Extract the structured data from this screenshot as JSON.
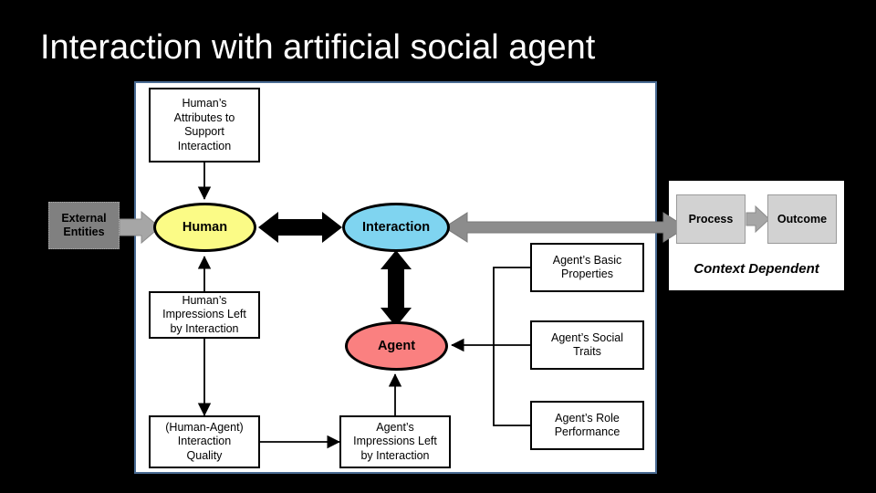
{
  "slide": {
    "title": "Interaction with artificial social agent",
    "background_color": "#000000",
    "title_color": "#ffffff"
  },
  "colors": {
    "human_fill": "#fbfb86",
    "interaction_fill": "#7fd4f0",
    "agent_fill": "#fa8080",
    "external_fill": "#808080",
    "process_fill": "#d2d2d2",
    "panel_border": "#4a6b93",
    "arrow_gray": "#8c8c8c",
    "arrow_black": "#000000"
  },
  "diagram": {
    "nodes": {
      "external_entities": "External\nEntities",
      "human": "Human",
      "interaction": "Interaction",
      "agent": "Agent",
      "human_attributes": "Human’s\nAttributes to\nSupport\nInteraction",
      "human_impressions": "Human’s\nImpressions Left\nby Interaction",
      "interaction_quality": "(Human-Agent)\nInteraction\nQuality",
      "agent_impressions": "Agent’s\nImpressions Left\nby Interaction",
      "agent_basic": "Agent’s Basic\nProperties",
      "agent_social": "Agent’s Social\nTraits",
      "agent_role": "Agent’s Role\nPerformance"
    },
    "context_panel": {
      "process": "Process",
      "outcome": "Outcome",
      "caption": "Context Dependent"
    }
  }
}
